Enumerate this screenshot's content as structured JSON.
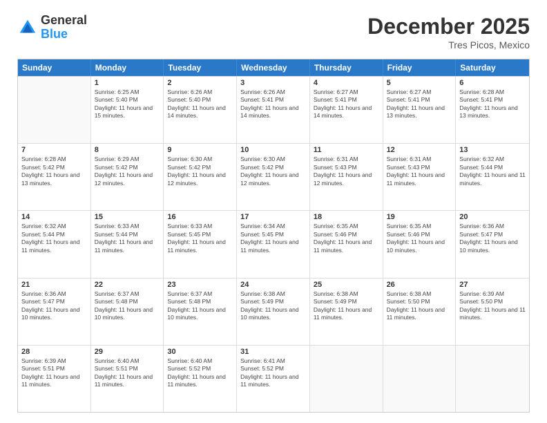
{
  "header": {
    "logo_general": "General",
    "logo_blue": "Blue",
    "month_title": "December 2025",
    "location": "Tres Picos, Mexico"
  },
  "calendar": {
    "days_of_week": [
      "Sunday",
      "Monday",
      "Tuesday",
      "Wednesday",
      "Thursday",
      "Friday",
      "Saturday"
    ],
    "rows": [
      [
        {
          "day": "",
          "empty": true
        },
        {
          "day": "1",
          "sunrise": "Sunrise: 6:25 AM",
          "sunset": "Sunset: 5:40 PM",
          "daylight": "Daylight: 11 hours and 15 minutes."
        },
        {
          "day": "2",
          "sunrise": "Sunrise: 6:26 AM",
          "sunset": "Sunset: 5:40 PM",
          "daylight": "Daylight: 11 hours and 14 minutes."
        },
        {
          "day": "3",
          "sunrise": "Sunrise: 6:26 AM",
          "sunset": "Sunset: 5:41 PM",
          "daylight": "Daylight: 11 hours and 14 minutes."
        },
        {
          "day": "4",
          "sunrise": "Sunrise: 6:27 AM",
          "sunset": "Sunset: 5:41 PM",
          "daylight": "Daylight: 11 hours and 14 minutes."
        },
        {
          "day": "5",
          "sunrise": "Sunrise: 6:27 AM",
          "sunset": "Sunset: 5:41 PM",
          "daylight": "Daylight: 11 hours and 13 minutes."
        },
        {
          "day": "6",
          "sunrise": "Sunrise: 6:28 AM",
          "sunset": "Sunset: 5:41 PM",
          "daylight": "Daylight: 11 hours and 13 minutes."
        }
      ],
      [
        {
          "day": "7",
          "sunrise": "Sunrise: 6:28 AM",
          "sunset": "Sunset: 5:42 PM",
          "daylight": "Daylight: 11 hours and 13 minutes."
        },
        {
          "day": "8",
          "sunrise": "Sunrise: 6:29 AM",
          "sunset": "Sunset: 5:42 PM",
          "daylight": "Daylight: 11 hours and 12 minutes."
        },
        {
          "day": "9",
          "sunrise": "Sunrise: 6:30 AM",
          "sunset": "Sunset: 5:42 PM",
          "daylight": "Daylight: 11 hours and 12 minutes."
        },
        {
          "day": "10",
          "sunrise": "Sunrise: 6:30 AM",
          "sunset": "Sunset: 5:42 PM",
          "daylight": "Daylight: 11 hours and 12 minutes."
        },
        {
          "day": "11",
          "sunrise": "Sunrise: 6:31 AM",
          "sunset": "Sunset: 5:43 PM",
          "daylight": "Daylight: 11 hours and 12 minutes."
        },
        {
          "day": "12",
          "sunrise": "Sunrise: 6:31 AM",
          "sunset": "Sunset: 5:43 PM",
          "daylight": "Daylight: 11 hours and 11 minutes."
        },
        {
          "day": "13",
          "sunrise": "Sunrise: 6:32 AM",
          "sunset": "Sunset: 5:44 PM",
          "daylight": "Daylight: 11 hours and 11 minutes."
        }
      ],
      [
        {
          "day": "14",
          "sunrise": "Sunrise: 6:32 AM",
          "sunset": "Sunset: 5:44 PM",
          "daylight": "Daylight: 11 hours and 11 minutes."
        },
        {
          "day": "15",
          "sunrise": "Sunrise: 6:33 AM",
          "sunset": "Sunset: 5:44 PM",
          "daylight": "Daylight: 11 hours and 11 minutes."
        },
        {
          "day": "16",
          "sunrise": "Sunrise: 6:33 AM",
          "sunset": "Sunset: 5:45 PM",
          "daylight": "Daylight: 11 hours and 11 minutes."
        },
        {
          "day": "17",
          "sunrise": "Sunrise: 6:34 AM",
          "sunset": "Sunset: 5:45 PM",
          "daylight": "Daylight: 11 hours and 11 minutes."
        },
        {
          "day": "18",
          "sunrise": "Sunrise: 6:35 AM",
          "sunset": "Sunset: 5:46 PM",
          "daylight": "Daylight: 11 hours and 11 minutes."
        },
        {
          "day": "19",
          "sunrise": "Sunrise: 6:35 AM",
          "sunset": "Sunset: 5:46 PM",
          "daylight": "Daylight: 11 hours and 10 minutes."
        },
        {
          "day": "20",
          "sunrise": "Sunrise: 6:36 AM",
          "sunset": "Sunset: 5:47 PM",
          "daylight": "Daylight: 11 hours and 10 minutes."
        }
      ],
      [
        {
          "day": "21",
          "sunrise": "Sunrise: 6:36 AM",
          "sunset": "Sunset: 5:47 PM",
          "daylight": "Daylight: 11 hours and 10 minutes."
        },
        {
          "day": "22",
          "sunrise": "Sunrise: 6:37 AM",
          "sunset": "Sunset: 5:48 PM",
          "daylight": "Daylight: 11 hours and 10 minutes."
        },
        {
          "day": "23",
          "sunrise": "Sunrise: 6:37 AM",
          "sunset": "Sunset: 5:48 PM",
          "daylight": "Daylight: 11 hours and 10 minutes."
        },
        {
          "day": "24",
          "sunrise": "Sunrise: 6:38 AM",
          "sunset": "Sunset: 5:49 PM",
          "daylight": "Daylight: 11 hours and 10 minutes."
        },
        {
          "day": "25",
          "sunrise": "Sunrise: 6:38 AM",
          "sunset": "Sunset: 5:49 PM",
          "daylight": "Daylight: 11 hours and 11 minutes."
        },
        {
          "day": "26",
          "sunrise": "Sunrise: 6:38 AM",
          "sunset": "Sunset: 5:50 PM",
          "daylight": "Daylight: 11 hours and 11 minutes."
        },
        {
          "day": "27",
          "sunrise": "Sunrise: 6:39 AM",
          "sunset": "Sunset: 5:50 PM",
          "daylight": "Daylight: 11 hours and 11 minutes."
        }
      ],
      [
        {
          "day": "28",
          "sunrise": "Sunrise: 6:39 AM",
          "sunset": "Sunset: 5:51 PM",
          "daylight": "Daylight: 11 hours and 11 minutes."
        },
        {
          "day": "29",
          "sunrise": "Sunrise: 6:40 AM",
          "sunset": "Sunset: 5:51 PM",
          "daylight": "Daylight: 11 hours and 11 minutes."
        },
        {
          "day": "30",
          "sunrise": "Sunrise: 6:40 AM",
          "sunset": "Sunset: 5:52 PM",
          "daylight": "Daylight: 11 hours and 11 minutes."
        },
        {
          "day": "31",
          "sunrise": "Sunrise: 6:41 AM",
          "sunset": "Sunset: 5:52 PM",
          "daylight": "Daylight: 11 hours and 11 minutes."
        },
        {
          "day": "",
          "empty": true
        },
        {
          "day": "",
          "empty": true
        },
        {
          "day": "",
          "empty": true
        }
      ]
    ]
  }
}
